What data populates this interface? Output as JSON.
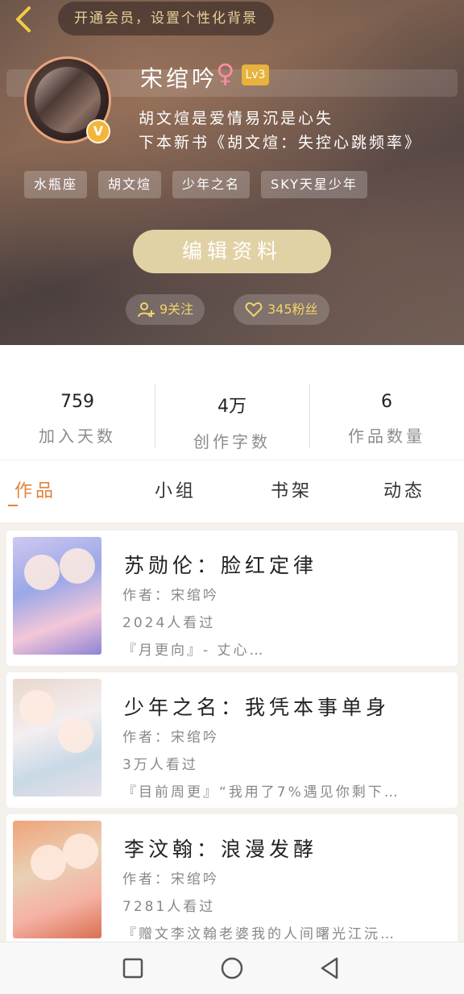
{
  "header": {
    "vip_banner": "开通会员，设置个性化背景",
    "faded_strip_text": "",
    "username": "宋绾吟",
    "gender_symbol": "♀",
    "level": "Lv3",
    "avatar_badge": "V",
    "bio_line1": "胡文煊是爱情易沉是心失",
    "bio_line2": "下本新书《胡文煊：失控心跳频率》",
    "tags": [
      "水瓶座",
      "胡文煊",
      "少年之名",
      "SKY天星少年"
    ],
    "edit_button": "编辑资料",
    "follow_label": "9关注",
    "fans_label": "345粉丝"
  },
  "stats": [
    {
      "value": "759",
      "label": "加入天数"
    },
    {
      "value": "4万",
      "label": "创作字数"
    },
    {
      "value": "6",
      "label": "作品数量"
    }
  ],
  "tabs": [
    "作品",
    "小组",
    "书架",
    "动态"
  ],
  "active_tab": "作品",
  "books": [
    {
      "title": "苏勋伦：脸红定律",
      "author": "作者：宋绾吟",
      "views": "2024人看过",
      "excerpt": "『月更向』- 丈心…"
    },
    {
      "title": "少年之名：我凭本事单身",
      "author": "作者：宋绾吟",
      "views": "3万人看过",
      "excerpt": "『目前周更』“我用了7%遇见你剩下…"
    },
    {
      "title": "李汶翰：浪漫发酵",
      "author": "作者：宋绾吟",
      "views": "7281人看过",
      "excerpt": "『赠文李汶翰老婆我的人间曙光江沅…"
    }
  ],
  "colors": {
    "accent": "#e3813e",
    "gold": "#f3d36a",
    "edit_button": "#e1d2a5"
  },
  "icons": {
    "back": "chevron-left",
    "follow": "user-plus",
    "fans": "heart",
    "nav_recent": "square",
    "nav_home": "circle",
    "nav_back": "triangle-left"
  }
}
